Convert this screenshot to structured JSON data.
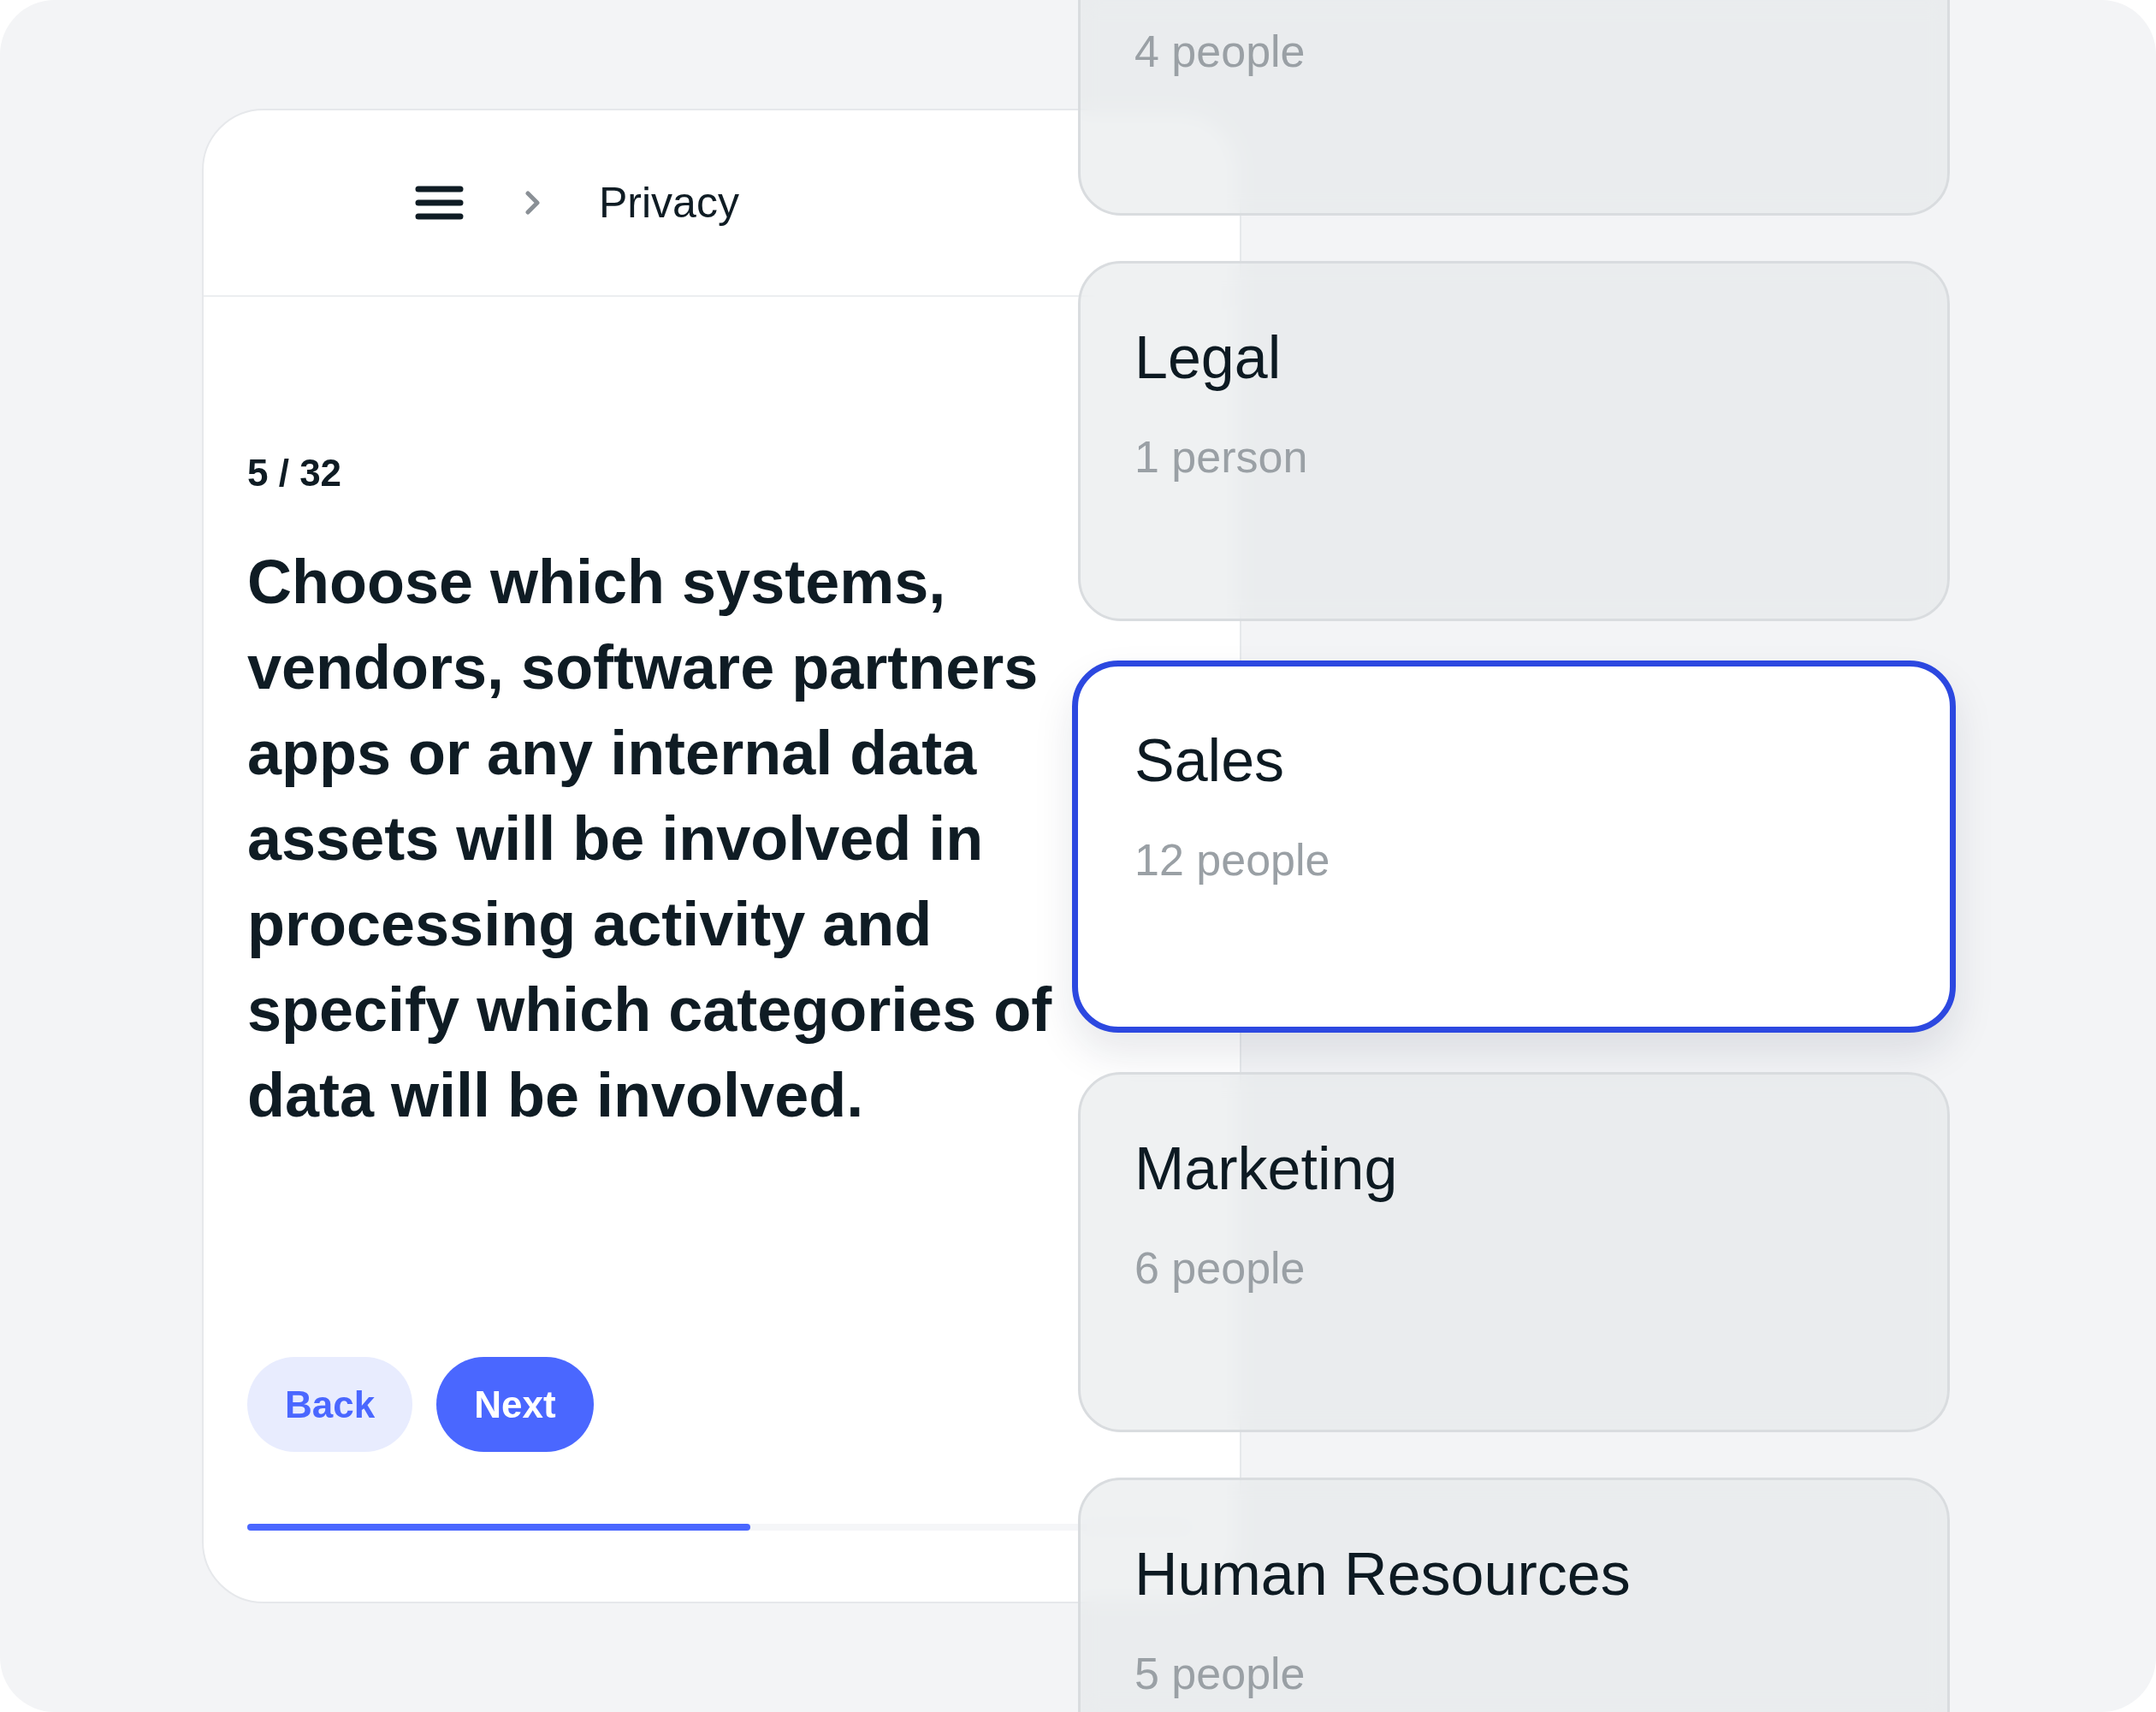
{
  "header": {
    "breadcrumb": "Privacy"
  },
  "question": {
    "counter": "5 / 32",
    "text": "Choose which systems, vendors, software partners apps or any internal data assets will be involved in processing activity and specify which categories of data will be involved."
  },
  "buttons": [
    {
      "label": "Back",
      "kind": "secondary"
    },
    {
      "label": "Next",
      "kind": "primary"
    }
  ],
  "progress": {
    "level": 0.53
  },
  "departments": [
    {
      "count": "4 people",
      "selected": false
    },
    {
      "name": "Legal",
      "count": "1 person",
      "selected": false
    },
    {
      "name": "Sales",
      "count": "12 people",
      "selected": true
    },
    {
      "name": "Marketing",
      "count": "6 people",
      "selected": false
    },
    {
      "name": "Human Resources",
      "count": "5 people",
      "selected": false
    }
  ]
}
